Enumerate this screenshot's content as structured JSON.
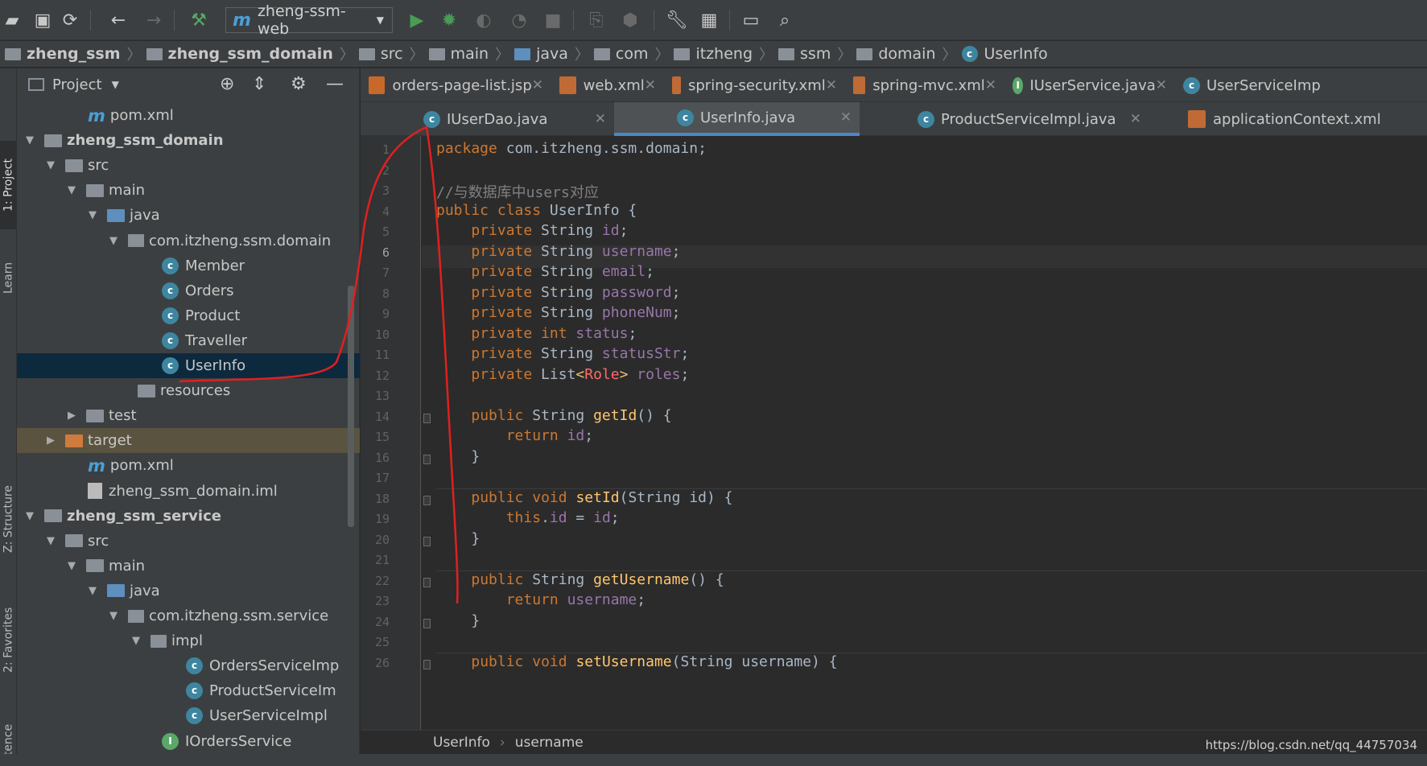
{
  "toolbar": {
    "run_config": "zheng-ssm-web",
    "icons": [
      "open-folder-icon",
      "save-icon",
      "sync-icon",
      "back-icon",
      "forward-icon",
      "build-hammer-icon",
      "run-icon",
      "debug-icon",
      "coverage-icon",
      "profile-icon",
      "stop-icon",
      "attach-icon",
      "deploy-icon",
      "settings-wrench-icon",
      "project-structure-icon",
      "terminal-icon",
      "search-icon"
    ]
  },
  "breadcrumb": [
    "zheng_ssm",
    "zheng_ssm_domain",
    "src",
    "main",
    "java",
    "com",
    "itzheng",
    "ssm",
    "domain",
    "UserInfo"
  ],
  "side_stripe": {
    "project": "1: Project",
    "learn": "Learn",
    "structure": "Z: Structure",
    "favorites": "2: Favorites",
    "persistence": "Persistence"
  },
  "project_panel": {
    "title": "Project",
    "tree": [
      {
        "label": "pom.xml",
        "type": "maven"
      },
      {
        "label": "zheng_ssm_domain",
        "type": "module",
        "bold": true
      },
      {
        "label": "src",
        "type": "folder"
      },
      {
        "label": "main",
        "type": "folder"
      },
      {
        "label": "java",
        "type": "folder-blue"
      },
      {
        "label": "com.itzheng.ssm.domain",
        "type": "package"
      },
      {
        "label": "Member",
        "type": "class"
      },
      {
        "label": "Orders",
        "type": "class"
      },
      {
        "label": "Product",
        "type": "class"
      },
      {
        "label": "Traveller",
        "type": "class"
      },
      {
        "label": "UserInfo",
        "type": "class",
        "selected": true
      },
      {
        "label": "resources",
        "type": "resources"
      },
      {
        "label": "test",
        "type": "folder"
      },
      {
        "label": "target",
        "type": "folder-orange"
      },
      {
        "label": "pom.xml",
        "type": "maven"
      },
      {
        "label": "zheng_ssm_domain.iml",
        "type": "iml"
      },
      {
        "label": "zheng_ssm_service",
        "type": "module",
        "bold": true
      },
      {
        "label": "src",
        "type": "folder"
      },
      {
        "label": "main",
        "type": "folder"
      },
      {
        "label": "java",
        "type": "folder-blue"
      },
      {
        "label": "com.itzheng.ssm.service",
        "type": "package"
      },
      {
        "label": "impl",
        "type": "package"
      },
      {
        "label": "OrdersServiceImp",
        "type": "class"
      },
      {
        "label": "ProductServiceIm",
        "type": "class"
      },
      {
        "label": "UserServiceImpl",
        "type": "class"
      },
      {
        "label": "IOrdersService",
        "type": "interface"
      }
    ]
  },
  "tabs_row1": [
    "orders-page-list.jsp",
    "web.xml",
    "spring-security.xml",
    "spring-mvc.xml",
    "IUserService.java",
    "UserServiceImp"
  ],
  "tabs_row2": [
    "IUserDao.java",
    "UserInfo.java",
    "ProductServiceImpl.java",
    "applicationContext.xml"
  ],
  "active_tab": "UserInfo.java",
  "code_lines": [
    "package com.itzheng.ssm.domain;",
    "",
    "//与数据库中users对应",
    "public class UserInfo {",
    "    private String id;",
    "    private String username;",
    "    private String email;",
    "    private String password;",
    "    private String phoneNum;",
    "    private int status;",
    "    private String statusStr;",
    "    private List<Role> roles;",
    "",
    "    public String getId() {",
    "        return id;",
    "    }",
    "",
    "    public void setId(String id) {",
    "        this.id = id;",
    "    }",
    "",
    "    public String getUsername() {",
    "        return username;",
    "    }",
    "",
    "    public void setUsername(String username) {"
  ],
  "editor_breadcrumb": {
    "class": "UserInfo",
    "member": "username"
  },
  "watermark": "https://blog.csdn.net/qq_44757034"
}
